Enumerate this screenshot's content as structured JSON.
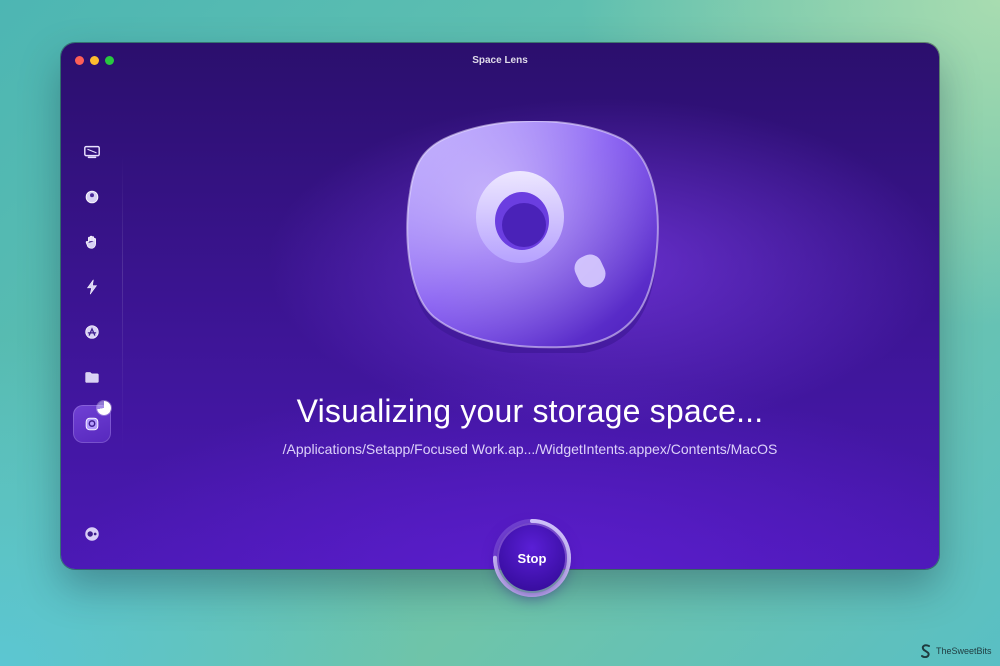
{
  "window": {
    "title": "Space Lens"
  },
  "sidebar": {
    "items": [
      {
        "name": "smart-scan",
        "icon": "monitor-icon"
      },
      {
        "name": "cleanup",
        "icon": "sphere-icon"
      },
      {
        "name": "protection",
        "icon": "hand-icon"
      },
      {
        "name": "performance",
        "icon": "lightning-icon"
      },
      {
        "name": "applications",
        "icon": "app-store-icon"
      },
      {
        "name": "my-clutter",
        "icon": "folder-icon"
      },
      {
        "name": "space-lens",
        "icon": "lens-icon",
        "active": true
      }
    ],
    "scan_progress": 0.72,
    "assistant_icon": "toggle-dot-icon"
  },
  "main": {
    "title": "Visualizing your storage space...",
    "scan_path": "/Applications/Setapp/Focused Work.ap.../WidgetIntents.appex/Contents/MacOS",
    "stop_label": "Stop",
    "stop_progress": 0.75
  },
  "watermark": {
    "text": "TheSweetBits"
  },
  "colors": {
    "accent": "#4b19b5",
    "window_top": "#2b0f6d",
    "stop_button": "#3c0fa6"
  }
}
